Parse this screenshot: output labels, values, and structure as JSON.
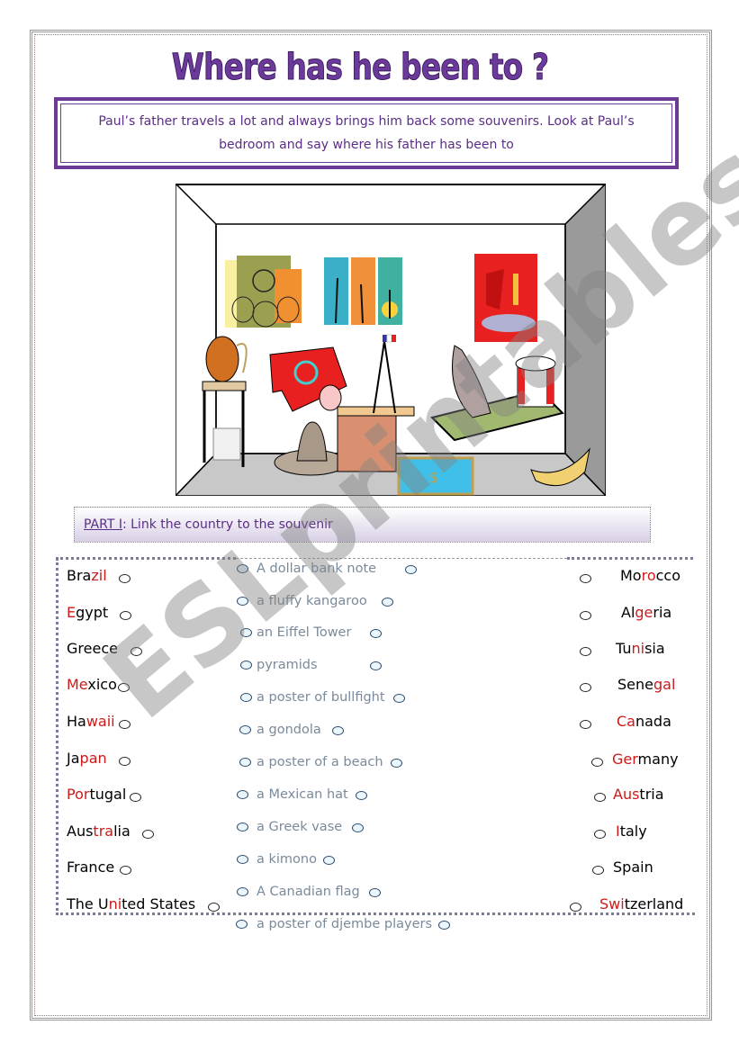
{
  "title": "Where has he been to ?",
  "instructions": "Paul’s father travels a lot and always brings him back some souvenirs. Look at Paul’s bedroom and say where his father has been to",
  "illustration": {
    "description": "Paul's bedroom full of souvenirs",
    "items": [
      "poster of djembe players",
      "poster of a beach",
      "poster of bullfight",
      "Greek vase",
      "kimono",
      "Eiffel Tower",
      "kangaroo",
      "Canadian flag hat",
      "Mexican hat",
      "dollar bank note",
      "gondola"
    ]
  },
  "part": {
    "label": "PART I",
    "text": ": Link the country to the souvenir"
  },
  "countries_left": [
    {
      "parts": [
        [
          "Bra",
          0
        ],
        [
          "zil",
          1
        ]
      ]
    },
    {
      "parts": [
        [
          "E",
          1
        ],
        [
          "gypt",
          0
        ]
      ]
    },
    {
      "parts": [
        [
          "Greece",
          0
        ]
      ]
    },
    {
      "parts": [
        [
          "Me",
          1
        ],
        [
          "xico",
          0
        ]
      ]
    },
    {
      "parts": [
        [
          "Ha",
          0
        ],
        [
          "waii",
          1
        ]
      ]
    },
    {
      "parts": [
        [
          "Ja",
          0
        ],
        [
          "pan",
          1
        ]
      ]
    },
    {
      "parts": [
        [
          "Por",
          1
        ],
        [
          "tugal",
          0
        ]
      ]
    },
    {
      "parts": [
        [
          "Aus",
          0
        ],
        [
          "tra",
          1
        ],
        [
          "lia",
          0
        ]
      ]
    },
    {
      "parts": [
        [
          "France",
          0
        ]
      ]
    },
    {
      "parts": [
        [
          "The U",
          0
        ],
        [
          "ni",
          1
        ],
        [
          "ted States",
          0
        ]
      ]
    }
  ],
  "souvenirs": [
    "A dollar bank note",
    "a fluffy kangaroo",
    "an Eiffel Tower",
    "pyramids",
    "a poster of bullfight",
    "a gondola",
    "a poster of a beach",
    "a Mexican hat",
    "a Greek vase",
    "a kimono",
    "A Canadian flag",
    "a poster of djembe players"
  ],
  "countries_right": [
    {
      "parts": [
        [
          "Mo",
          0
        ],
        [
          "ro",
          1
        ],
        [
          "cco",
          0
        ]
      ]
    },
    {
      "parts": [
        [
          "Al",
          0
        ],
        [
          "ge",
          1
        ],
        [
          "ria",
          0
        ]
      ]
    },
    {
      "parts": [
        [
          "Tu",
          0
        ],
        [
          "ni",
          1
        ],
        [
          "sia",
          0
        ]
      ]
    },
    {
      "parts": [
        [
          "Sene",
          0
        ],
        [
          "gal",
          1
        ]
      ]
    },
    {
      "parts": [
        [
          "Ca",
          1
        ],
        [
          "nada",
          0
        ]
      ]
    },
    {
      "parts": [
        [
          "Ger",
          1
        ],
        [
          "many",
          0
        ]
      ]
    },
    {
      "parts": [
        [
          "Aus",
          1
        ],
        [
          "tria",
          0
        ]
      ]
    },
    {
      "parts": [
        [
          "I",
          1
        ],
        [
          "taly",
          0
        ]
      ]
    },
    {
      "parts": [
        [
          "Spain",
          0
        ]
      ]
    },
    {
      "parts": [
        [
          "Swi",
          1
        ],
        [
          "tzerland",
          0
        ]
      ]
    }
  ],
  "watermark": "ESLprintables.com",
  "colors": {
    "title": "#6b3a9a",
    "highlight": "#cc1a1a",
    "souvenir_text": "#7a8a9a"
  }
}
